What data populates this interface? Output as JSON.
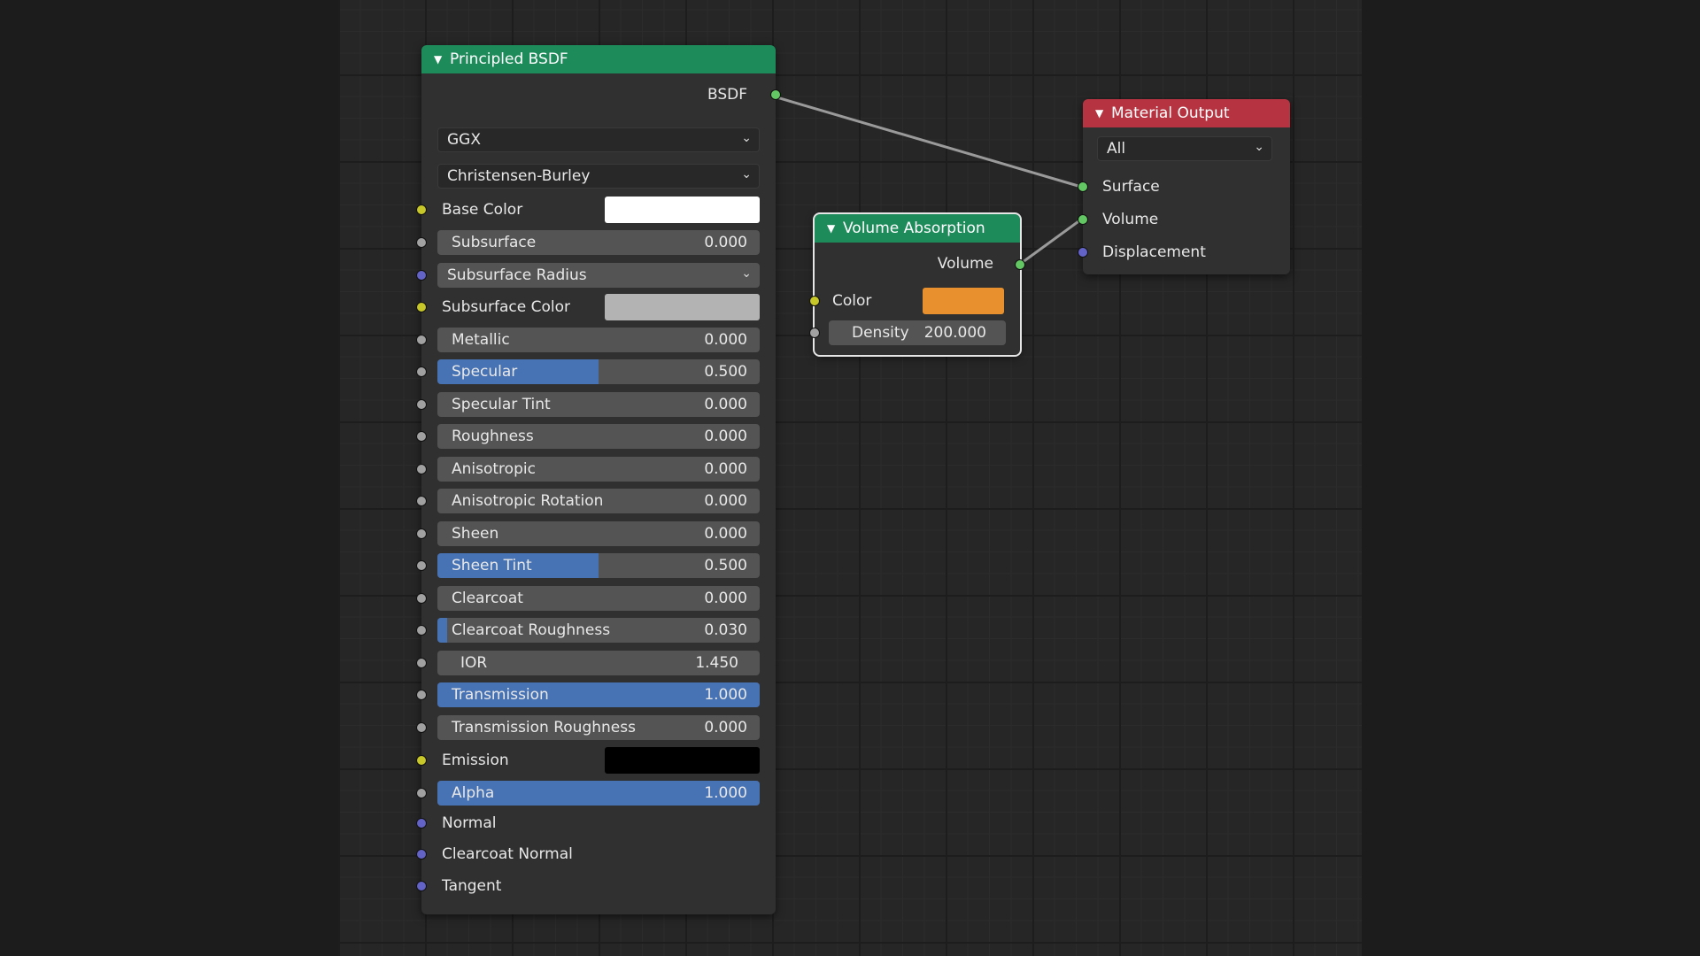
{
  "principled": {
    "title": "Principled BSDF",
    "output": "BSDF",
    "distribution": "GGX",
    "subsurface_method": "Christensen-Burley",
    "base_color_label": "Base Color",
    "base_color": "#ffffff",
    "subsurface_radius": "Subsurface Radius",
    "subsurface_color_label": "Subsurface Color",
    "subsurface_color": "#b3b3b3",
    "emission_label": "Emission",
    "emission_color": "#000000",
    "sliders": [
      {
        "label": "Subsurface",
        "value": "0.000",
        "fill": 0.0
      },
      {
        "label": "Metallic",
        "value": "0.000",
        "fill": 0.0
      },
      {
        "label": "Specular",
        "value": "0.500",
        "fill": 0.5
      },
      {
        "label": "Specular Tint",
        "value": "0.000",
        "fill": 0.0
      },
      {
        "label": "Roughness",
        "value": "0.000",
        "fill": 0.0
      },
      {
        "label": "Anisotropic",
        "value": "0.000",
        "fill": 0.0
      },
      {
        "label": "Anisotropic Rotation",
        "value": "0.000",
        "fill": 0.0
      },
      {
        "label": "Sheen",
        "value": "0.000",
        "fill": 0.0
      },
      {
        "label": "Sheen Tint",
        "value": "0.500",
        "fill": 0.5
      },
      {
        "label": "Clearcoat",
        "value": "0.000",
        "fill": 0.0
      },
      {
        "label": "Clearcoat Roughness",
        "value": "0.030",
        "fill": 0.03
      },
      {
        "label": "IOR",
        "value": "1.450",
        "fill": 0.0
      },
      {
        "label": "Transmission",
        "value": "1.000",
        "fill": 1.0
      },
      {
        "label": "Transmission Roughness",
        "value": "0.000",
        "fill": 0.0
      },
      {
        "label": "Alpha",
        "value": "1.000",
        "fill": 1.0
      }
    ],
    "vector_inputs": [
      "Normal",
      "Clearcoat Normal",
      "Tangent"
    ]
  },
  "volume": {
    "title": "Volume Absorption",
    "output": "Volume",
    "color_label": "Color",
    "color": "#e8902e",
    "density_label": "Density",
    "density_value": "200.000"
  },
  "material_output": {
    "title": "Material Output",
    "target": "All",
    "inputs": [
      "Surface",
      "Volume",
      "Displacement"
    ]
  },
  "colors": {
    "header_green": "#1e8b5b",
    "header_red": "#b63441",
    "slider_fill": "#4772b3",
    "socket_shader": "#63c763",
    "socket_color": "#c7c729",
    "socket_float": "#a1a1a1",
    "socket_vector": "#6363c7"
  }
}
